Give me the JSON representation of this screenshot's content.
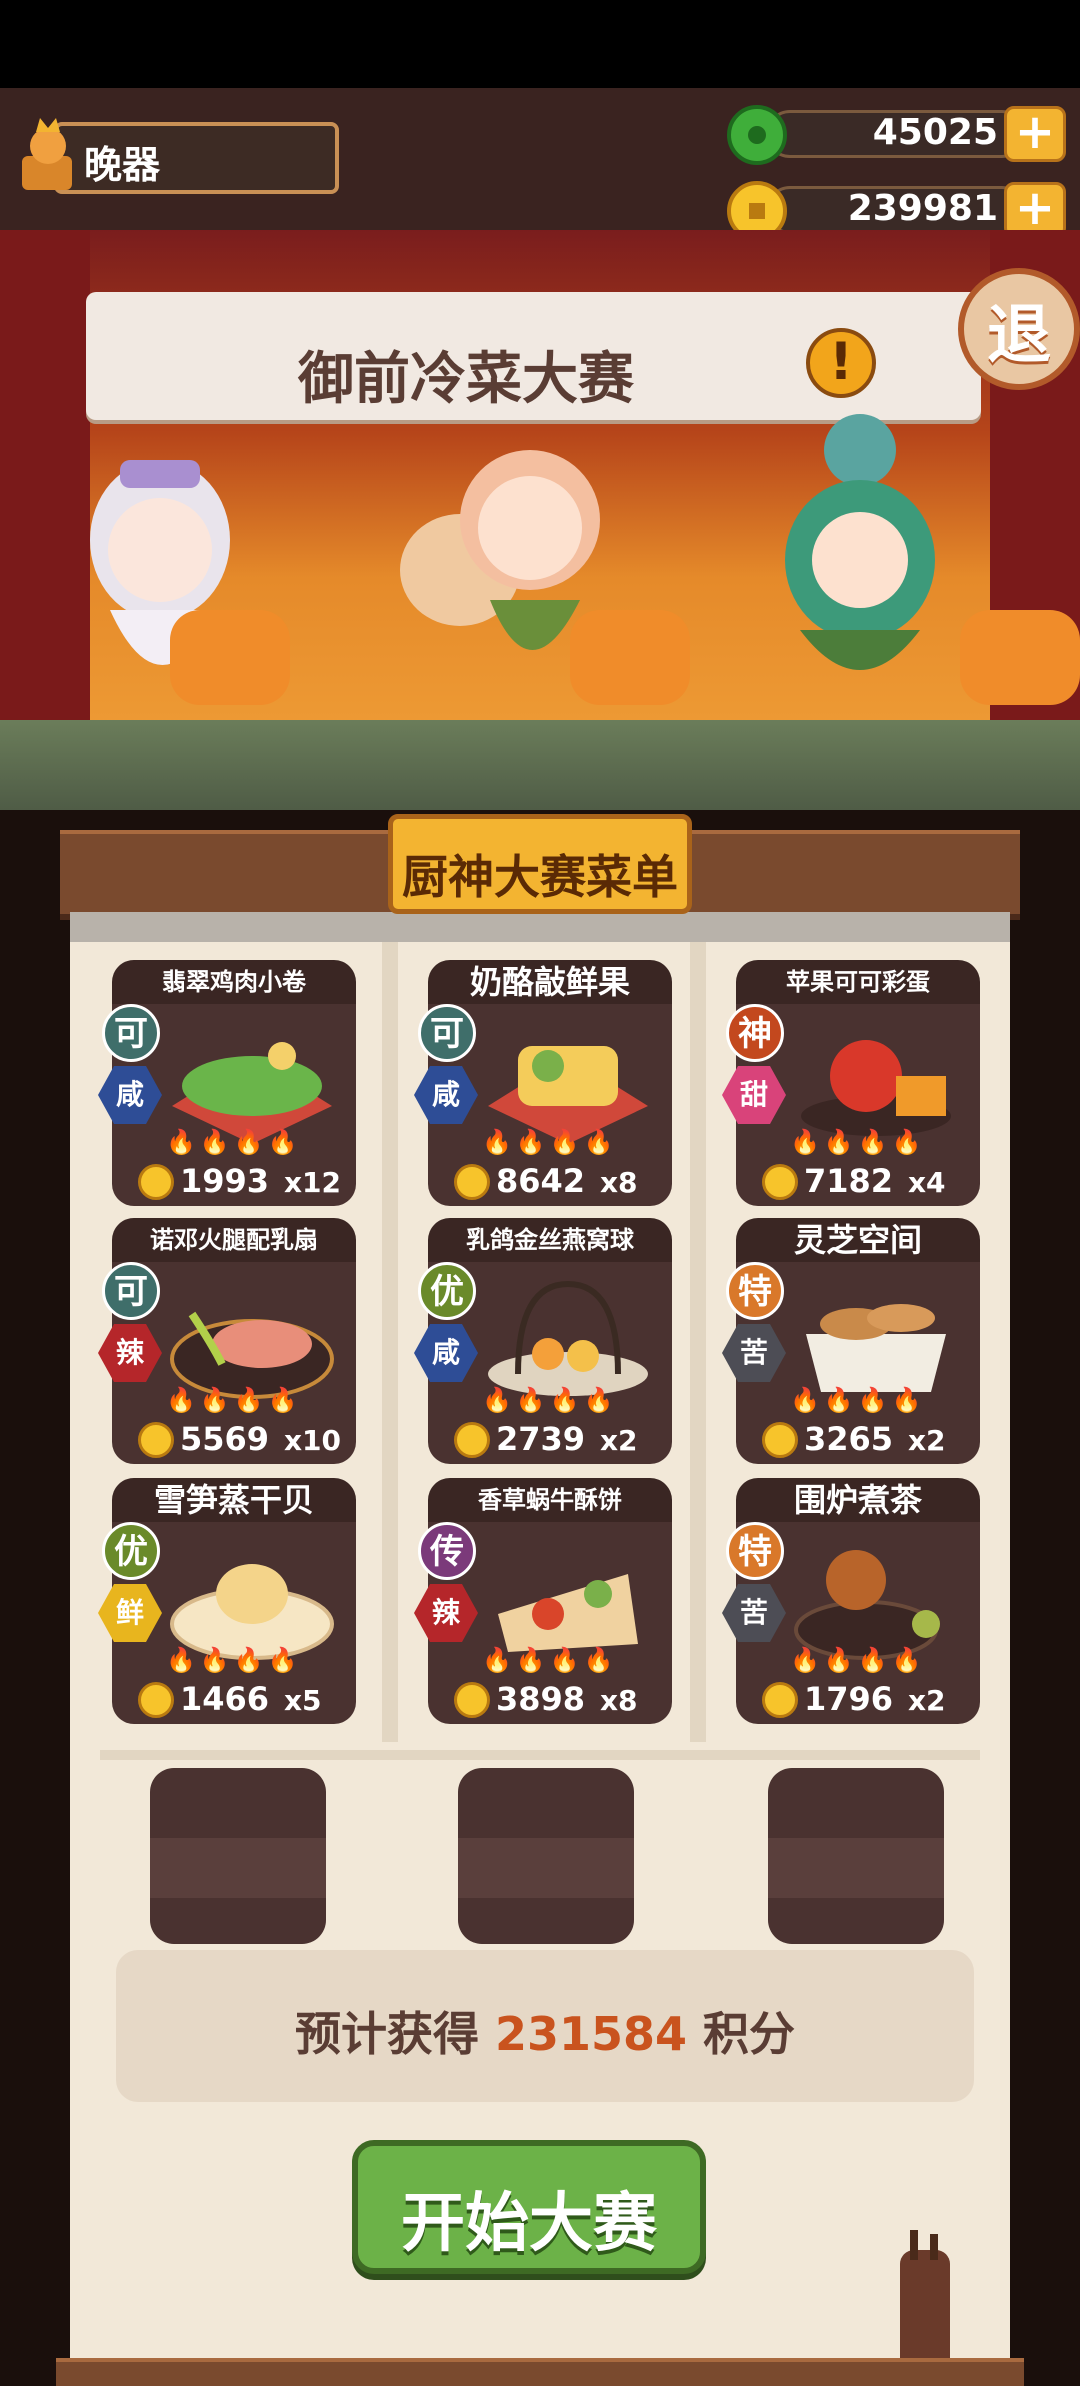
{
  "player": {
    "name": "晚器"
  },
  "resources": {
    "jade": "45025",
    "coins": "239981"
  },
  "banner": {
    "title": "御前冷菜大赛",
    "exit_label": "退"
  },
  "menu": {
    "title": "厨神大赛菜单",
    "dishes": [
      {
        "name": "翡翠鸡肉小卷",
        "grade": "可",
        "taste": "咸",
        "price": "1993",
        "qty": "x12"
      },
      {
        "name": "奶酪敲鲜果",
        "grade": "可",
        "taste": "咸",
        "price": "8642",
        "qty": "x8"
      },
      {
        "name": "苹果可可彩蛋",
        "grade": "神",
        "taste": "甜",
        "price": "7182",
        "qty": "x4"
      },
      {
        "name": "诺邓火腿配乳扇",
        "grade": "可",
        "taste": "辣",
        "price": "5569",
        "qty": "x10"
      },
      {
        "name": "乳鸽金丝燕窝球",
        "grade": "优",
        "taste": "咸",
        "price": "2739",
        "qty": "x2"
      },
      {
        "name": "灵芝空间",
        "grade": "特",
        "taste": "苦",
        "price": "3265",
        "qty": "x2"
      },
      {
        "name": "雪笋蒸干贝",
        "grade": "优",
        "taste": "鲜",
        "price": "1466",
        "qty": "x5"
      },
      {
        "name": "香草蜗牛酥饼",
        "grade": "传",
        "taste": "辣",
        "price": "3898",
        "qty": "x8"
      },
      {
        "name": "围炉煮茶",
        "grade": "特",
        "taste": "苦",
        "price": "1796",
        "qty": "x2"
      }
    ],
    "flames": "🔥🔥🔥🔥"
  },
  "estimate": {
    "prefix": "预计获得",
    "value": "231584",
    "suffix": "积分"
  },
  "start_button": {
    "label": "开始大赛"
  },
  "colors": {
    "grade_可": "#3f6e6a",
    "grade_神": "#c3481e",
    "grade_优": "#6a8a2a",
    "grade_特": "#d9782a",
    "grade_传": "#7b3a7a",
    "taste_咸": "#2e4d96",
    "taste_甜": "#d9437a",
    "taste_辣": "#b5262a",
    "taste_苦": "#4d4d55",
    "taste_鲜": "#e8b51e"
  }
}
